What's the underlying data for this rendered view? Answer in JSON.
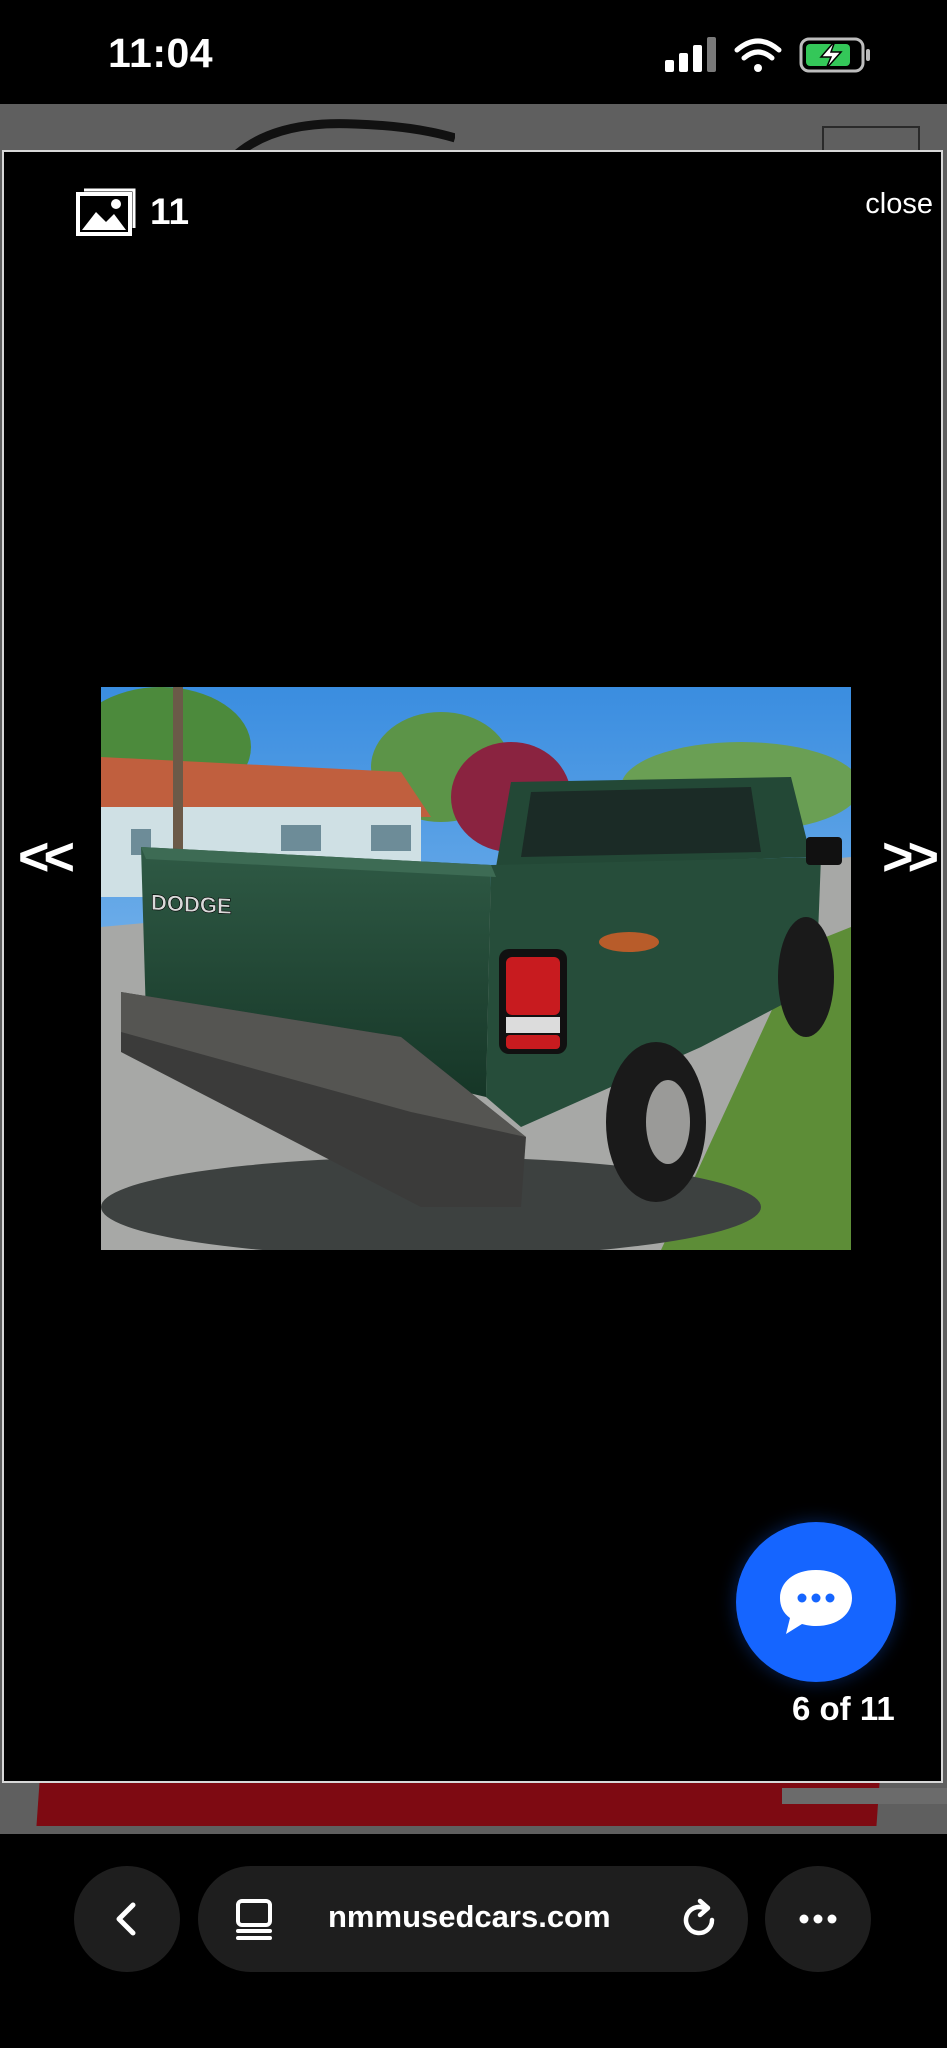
{
  "status_bar": {
    "time": "11:04",
    "icons": [
      "cellular-signal-icon",
      "wifi-icon",
      "battery-charging-icon"
    ],
    "battery_color": "#34c759"
  },
  "lightbox": {
    "photo_count": "11",
    "close_label": "close",
    "prev_label": "<<",
    "next_label": ">>",
    "counter": "6 of 11",
    "photo_alt": "Green Dodge pickup truck, rear view",
    "tailgate_badge": "DODGE",
    "chat_icon": "chat-bubble-icon",
    "chat_color": "#1565ff"
  },
  "browser": {
    "url": "nmmusedcars.com",
    "back_icon": "chevron-left-icon",
    "reader_icon": "page-icon",
    "reload_icon": "reload-icon",
    "more_icon": "ellipsis-icon"
  }
}
